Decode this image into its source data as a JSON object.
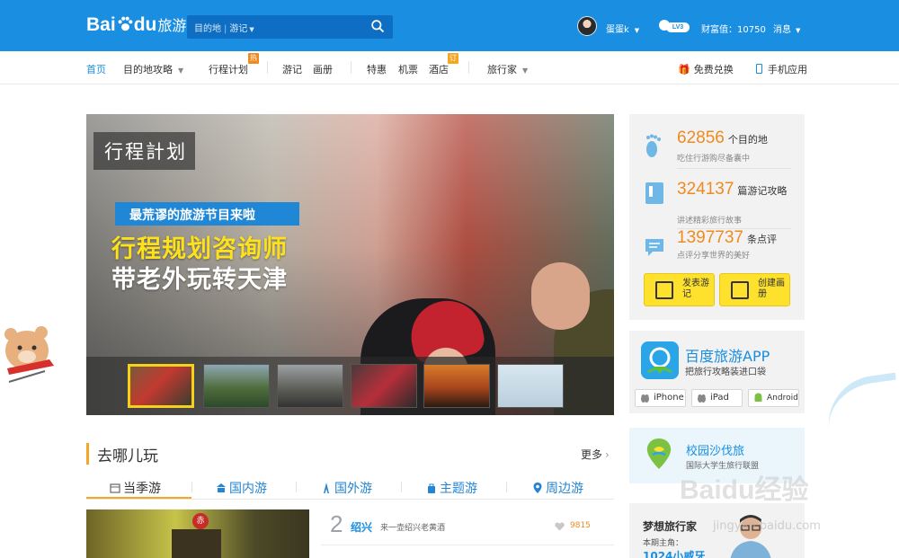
{
  "colors": {
    "brand": "#1a8ee1",
    "accent": "#f08a1f",
    "yellow": "#fde12d",
    "section_bar": "#f5a623"
  },
  "header": {
    "logo_main": "Bai",
    "logo_tail": "du",
    "logo_sub": "旅游",
    "search": {
      "option_destination": "目的地",
      "option_notes": "游记"
    },
    "user": {
      "name": "蛋蛋k",
      "level": "LV3",
      "wealth": "财富值：10750",
      "messages": "消息"
    }
  },
  "nav": {
    "items": [
      "首页",
      "目的地攻略",
      "行程计划",
      "游记",
      "画册",
      "特惠",
      "机票",
      "酒店",
      "旅行家"
    ],
    "tag_hot": "热",
    "tag_order": "订",
    "right_free": "免费兑换",
    "right_mobile": "手机应用"
  },
  "banner": {
    "corner_tag": "行程計划",
    "headline_small": "最荒谬的旅游节目来啦",
    "headline_line1": "行程规划咨询师",
    "headline_line2": "带老外玩转天津"
  },
  "stats": [
    {
      "number": "62856",
      "unit": "个目的地",
      "desc": "吃住行游购尽备囊中"
    },
    {
      "number": "324137",
      "unit": "篇游记攻略",
      "desc": "讲述精彩旅行故事"
    },
    {
      "number": "1397737",
      "unit": "条点评",
      "desc": "点评分享世界的美好"
    }
  ],
  "buttons": {
    "post_notes": "发表游记",
    "create_album": "创建画册"
  },
  "app": {
    "title": "百度旅游APP",
    "subtitle": "把旅行攻略装进口袋",
    "platforms": [
      "iPhone",
      "iPad",
      "Android"
    ]
  },
  "campus": {
    "title": "校园沙伐旅",
    "subtitle": "国际大学生旅行联盟"
  },
  "dream": {
    "title": "梦想旅行家",
    "label": "本期主角：",
    "name": "1024小威牙"
  },
  "section": {
    "title": "去哪儿玩",
    "more": "更多",
    "tabs": [
      "当季游",
      "国内游",
      "国外游",
      "主题游",
      "周边游"
    ]
  },
  "gate_sign": "赤",
  "ranking": [
    {
      "rank": "2",
      "city": "绍兴",
      "desc": "来一壶绍兴老黄酒",
      "likes": "9815"
    }
  ],
  "watermark": {
    "main": "Baidu经验",
    "url": "jingyan.baidu.com"
  }
}
